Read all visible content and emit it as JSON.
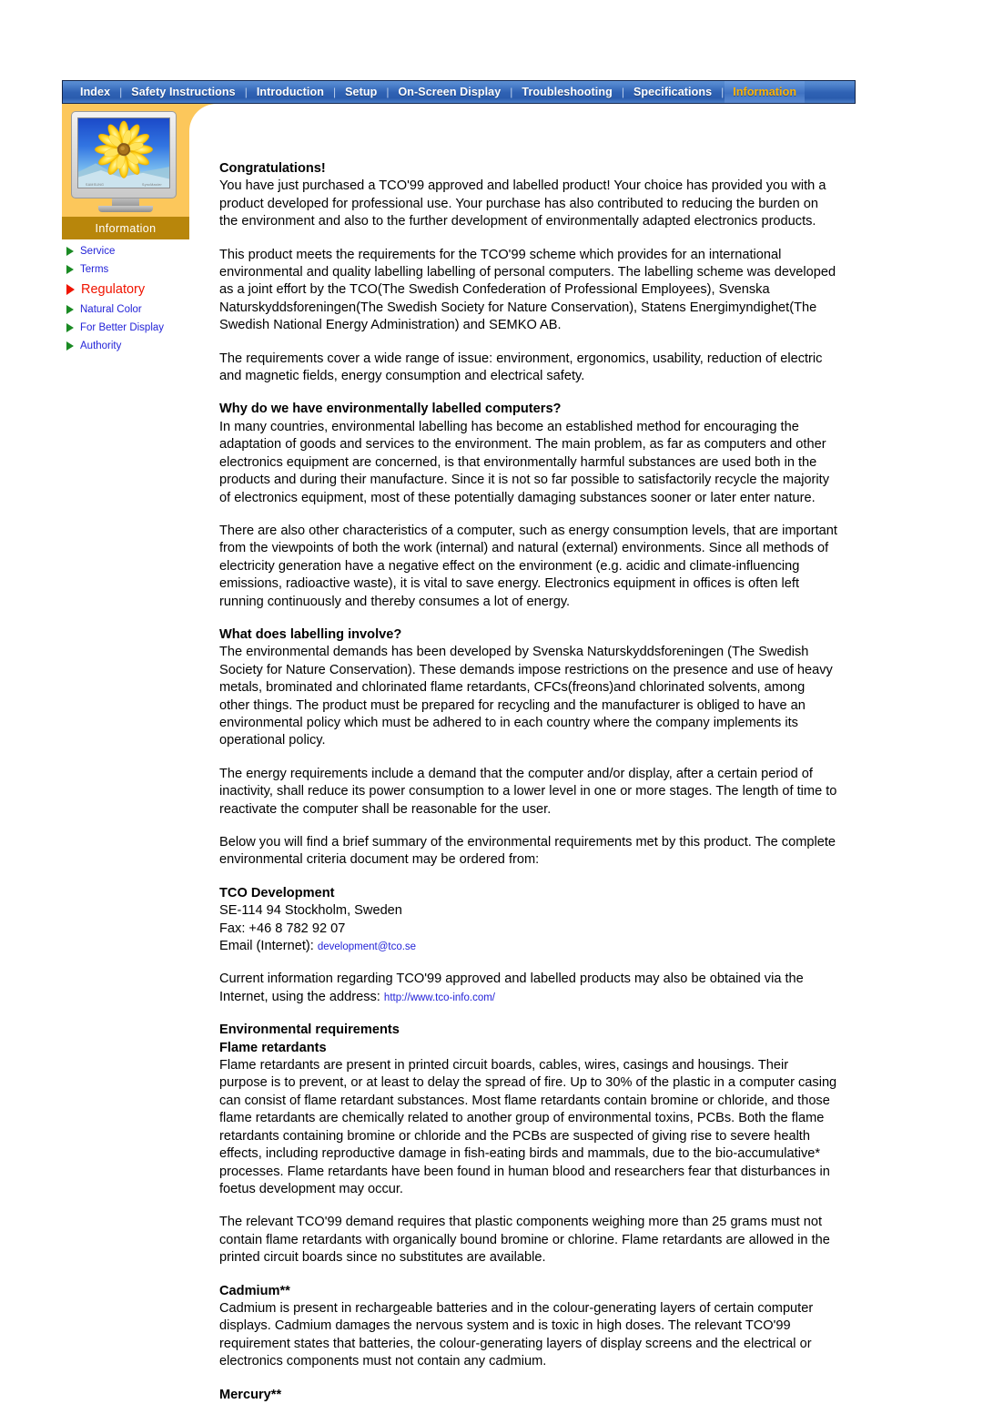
{
  "nav": {
    "separator": "|",
    "items": [
      {
        "label": "Index",
        "active": false
      },
      {
        "label": "Safety Instructions",
        "active": false
      },
      {
        "label": "Introduction",
        "active": false
      },
      {
        "label": "Setup",
        "active": false
      },
      {
        "label": "On-Screen Display",
        "active": false
      },
      {
        "label": "Troubleshooting",
        "active": false
      },
      {
        "label": "Specifications",
        "active": false
      },
      {
        "label": "Information",
        "active": true
      }
    ]
  },
  "sidebar": {
    "section_title": "Information",
    "monitor_brand_left": "SAMSUNG",
    "monitor_brand_right": "SyncMaster",
    "items": [
      {
        "label": "Service",
        "active": false
      },
      {
        "label": "Terms",
        "active": false
      },
      {
        "label": "Regulatory",
        "active": true
      },
      {
        "label": "Natural Color",
        "active": false
      },
      {
        "label": "For Better Display",
        "active": false
      },
      {
        "label": "Authority",
        "active": false
      }
    ]
  },
  "colors": {
    "nav_blue": "#2f62b4",
    "nav_active_text": "#ffb300",
    "panel_orange": "#fcc75b",
    "info_bar_gold": "#b8860b",
    "link_blue": "#2323d8",
    "active_red": "#f01400",
    "arrow_green": "#1a8a23"
  },
  "content": {
    "h_congratulations": "Congratulations!",
    "p_congrats": "You have just purchased a TCO'99 approved and labelled product! Your choice has provided you with a product developed for professional use. Your purchase has also contributed to reducing the burden on the environment and also to the further development of environmentally adapted electronics products.",
    "p_scheme": "This product meets the requirements for the TCO'99 scheme which provides for an international environmental and quality labelling labelling of personal computers. The labelling scheme was developed as a joint effort by the TCO(The Swedish Confederation of Professional Employees), Svenska Naturskyddsforeningen(The Swedish Society for Nature Conservation), Statens Energimyndighet(The Swedish National Energy Administration) and SEMKO AB.",
    "p_requirements_cover": "The requirements cover a wide range of issue: environment, ergonomics, usability, reduction of electric and magnetic fields, energy consumption and electrical safety.",
    "h_why_labelled": "Why do we have environmentally labelled computers?",
    "p_why_labelled": "In many countries, environmental labelling has become an established method for encouraging the adaptation of goods and services to the environment. The main problem, as far as computers and other electronics equipment are concerned, is that environmentally harmful substances are used both in the products and during their manufacture. Since it is not so far possible to satisfactorily recycle the majority of electronics equipment, most of these potentially damaging substances sooner or later enter nature.",
    "p_other_characteristics": "There are also other characteristics of a computer, such as energy consumption levels, that are important from the viewpoints of both the work (internal) and natural (external) environments. Since all methods of electricity generation have a negative effect on the environment (e.g. acidic and climate-influencing emissions, radioactive waste), it is vital to save energy. Electronics equipment in offices is often left running continuously and thereby consumes a lot of energy.",
    "h_what_involve": "What does labelling involve?",
    "p_what_involve": "The environmental demands has been developed by Svenska Naturskyddsforeningen (The Swedish Society for Nature Conservation). These demands impose restrictions on the presence and use of heavy metals, brominated and chlorinated flame retardants, CFCs(freons)and chlorinated solvents, among other things. The product must be prepared for recycling and the manufacturer is obliged to have an environmental policy which must be adhered to in each country where the company implements its operational policy.",
    "p_energy_requirements": "The energy requirements include a demand that the computer and/or display, after a certain period of inactivity, shall reduce its power consumption to a lower level in one or more stages. The length of time to reactivate the computer shall be reasonable for the user.",
    "p_below_summary": "Below you will find a brief summary of the environmental requirements met by this product. The complete environmental criteria document may be ordered from:",
    "h_tco_development": "TCO Development",
    "addr_line1": "SE-114 94 Stockholm, Sweden",
    "addr_line2": "Fax: +46 8 782 92 07",
    "addr_email_label": "Email (Internet):",
    "addr_email": "development@tco.se",
    "p_current_info_prefix": "Current information regarding TCO'99 approved and labelled products may also be obtained via the Internet, using the address:",
    "url": "http://www.tco-info.com/",
    "h_env_requirements": "Environmental requirements",
    "h_flame_retardants": "Flame retardants",
    "p_flame_retardants": "Flame retardants are present in printed circuit boards, cables, wires, casings and housings. Their purpose is to prevent, or at least to delay the spread of fire. Up to 30% of the plastic in a computer casing can consist of flame retardant substances. Most flame retardants contain bromine or chloride, and those flame retardants are chemically related to another group of environmental toxins, PCBs. Both the flame retardants containing bromine or chloride and the PCBs are suspected of giving rise to severe health effects, including reproductive damage in fish-eating birds and mammals, due to the bio-accumulative* processes. Flame retardants have been found in human blood and researchers fear that disturbances in foetus development may occur.",
    "p_relevant_demand": "The relevant TCO'99 demand requires that plastic components weighing more than 25 grams must not contain flame retardants with organically bound bromine or chlorine. Flame retardants are allowed in the printed circuit boards since no substitutes are available.",
    "h_cadmium": "Cadmium**",
    "p_cadmium": "Cadmium is present in rechargeable batteries and in the colour-generating layers of certain computer displays. Cadmium damages the nervous system and is toxic in high doses. The relevant TCO'99 requirement states that batteries, the colour-generating layers of display screens and the electrical or electronics components must not contain any cadmium.",
    "h_mercury": "Mercury**"
  }
}
